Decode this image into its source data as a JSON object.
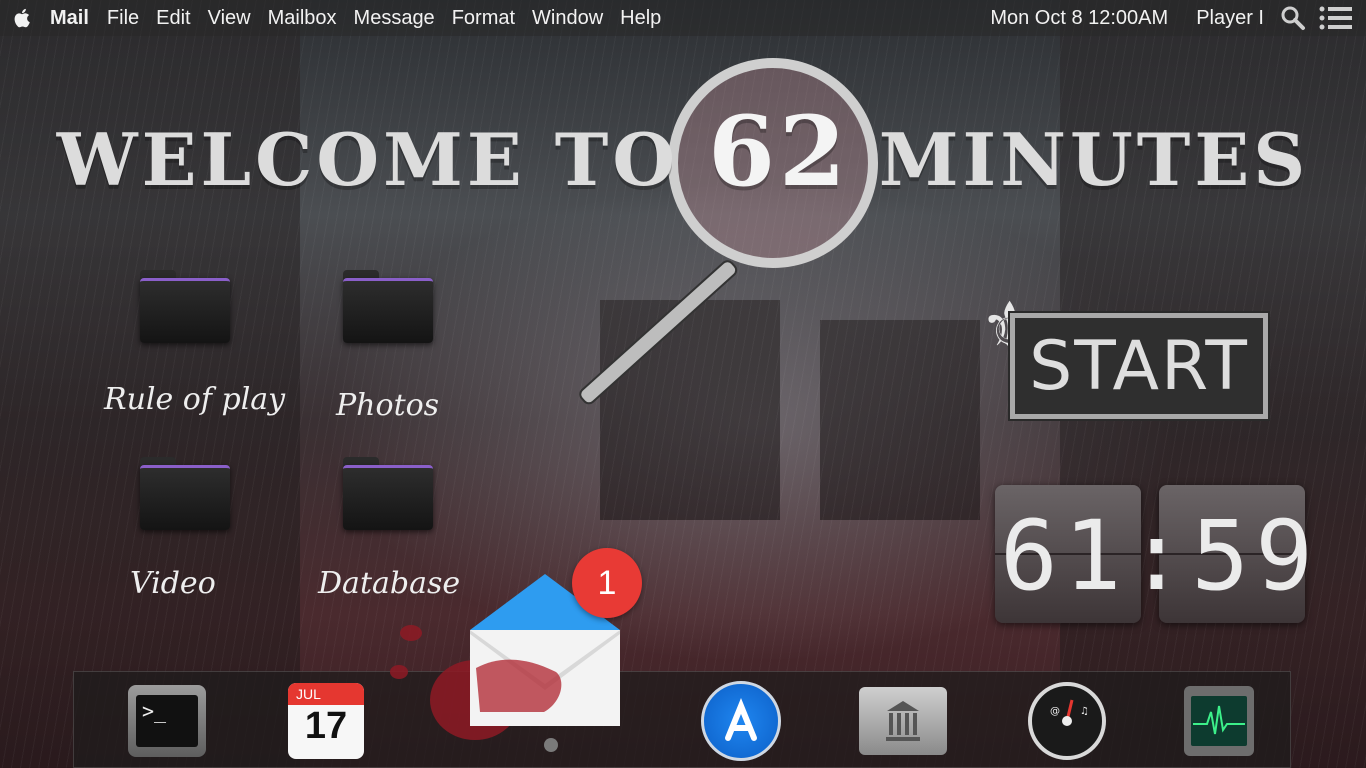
{
  "menubar": {
    "app_name": "Mail",
    "items": [
      "File",
      "Edit",
      "View",
      "Mailbox",
      "Message",
      "Format",
      "Window",
      "Help"
    ],
    "clock": "Mon Oct 8 12:00AM",
    "user": "Player I"
  },
  "title": {
    "part1": "WELCOME TO ",
    "number": "62",
    "part2": " MINUTES"
  },
  "folders": [
    "Rule of play",
    "Photos",
    "Video",
    "Database"
  ],
  "start_label": "START",
  "timer": "61:59",
  "dock": {
    "terminal_prompt": ">_",
    "calendar_month": "JUL",
    "calendar_day": "17",
    "mail_badge": "1"
  },
  "colors": {
    "badge": "#e83a35",
    "folder_accent": "#8a5fc9",
    "appstore_blue": "#1f86f0"
  }
}
